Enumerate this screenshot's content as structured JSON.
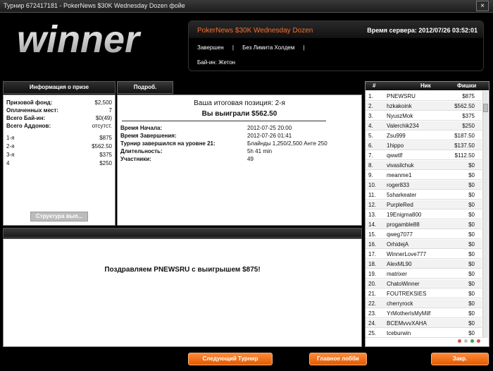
{
  "window": {
    "title": "Турнир 672417181 - PokerNews $30K Wednesday Dozen фойе",
    "close": "×"
  },
  "logo": {
    "text": "winner"
  },
  "header": {
    "tournament_name": "PokerNews $30K Wednesday Dozen",
    "server_time": "Время сервера: 2012/07/26 03:52:01",
    "status": "Завершен",
    "separator": "|",
    "game_type": "Без Лимита Холдем",
    "buyin": "Бай-ин: Жетон"
  },
  "prize_info": {
    "tab_label": "Информация о призе",
    "rows": [
      {
        "label": "Призовой фонд:",
        "value": "$2,500"
      },
      {
        "label": "Оплаченных мест:",
        "value": "7"
      },
      {
        "label": "Всего Бай-ин:",
        "value": "$0(49)"
      },
      {
        "label": "Всего Аддонов:",
        "value": "отсутст."
      }
    ],
    "places": [
      {
        "label": "1-я",
        "value": "$875"
      },
      {
        "label": "2-я",
        "value": "$562.50"
      },
      {
        "label": "3-я",
        "value": "$375"
      },
      {
        "label": "4",
        "value": "$250"
      }
    ],
    "structure_button": "Структура вып..."
  },
  "details": {
    "tab_label": "Подроб.",
    "final_position": "Ваша итоговая позиция: 2-я",
    "winnings": "Вы выиграли $562.50",
    "rows": [
      {
        "label": "Время Начала:",
        "value": "2012-07-25 20:00"
      },
      {
        "label": "Время Завершения:",
        "value": "2012-07-26 01:41"
      },
      {
        "label": "Турнир завершился на уровне 21:",
        "value": "Блайнды 1,250/2,500 Анте 250"
      },
      {
        "label": "Длительность:",
        "value": "5h 41 min"
      },
      {
        "label": "Участники:",
        "value": "49"
      }
    ]
  },
  "message": {
    "text": "Поздравляем PNEWSRU с выигрышем $875!"
  },
  "players": {
    "col_num": "#",
    "col_nick": "Ник",
    "col_chips": "Фишки",
    "rows": [
      {
        "n": "1.",
        "name": "PNEWSRU",
        "chips": "$875"
      },
      {
        "n": "2.",
        "name": "hzkakoink",
        "chips": "$562.50"
      },
      {
        "n": "3.",
        "name": "NyuszMok",
        "chips": "$375"
      },
      {
        "n": "4.",
        "name": "Valerchik234",
        "chips": "$250"
      },
      {
        "n": "5.",
        "name": "Zsu999",
        "chips": "$187.50"
      },
      {
        "n": "6.",
        "name": "1hippo",
        "chips": "$137.50"
      },
      {
        "n": "7.",
        "name": "qwwtlf",
        "chips": "$112.50"
      },
      {
        "n": "8.",
        "name": "vivasilchuk",
        "chips": "$0"
      },
      {
        "n": "9.",
        "name": "meanme1",
        "chips": "$0"
      },
      {
        "n": "10.",
        "name": "roger833",
        "chips": "$0"
      },
      {
        "n": "11.",
        "name": "5sharkeater",
        "chips": "$0"
      },
      {
        "n": "12.",
        "name": "PurpleRed",
        "chips": "$0"
      },
      {
        "n": "13.",
        "name": "19Enigma800",
        "chips": "$0"
      },
      {
        "n": "14.",
        "name": "progamble88",
        "chips": "$0"
      },
      {
        "n": "15.",
        "name": "qweg7077",
        "chips": "$0"
      },
      {
        "n": "16.",
        "name": "OrhidejA",
        "chips": "$0"
      },
      {
        "n": "17.",
        "name": "WinnerLove777",
        "chips": "$0"
      },
      {
        "n": "18.",
        "name": "AlexML90",
        "chips": "$0"
      },
      {
        "n": "19.",
        "name": "matrixer",
        "chips": "$0"
      },
      {
        "n": "20.",
        "name": "ChatoWinner",
        "chips": "$0"
      },
      {
        "n": "21.",
        "name": "FOUTREKSIES",
        "chips": "$0"
      },
      {
        "n": "22.",
        "name": "cherryrock",
        "chips": "$0"
      },
      {
        "n": "23.",
        "name": "YrMotherIsMyMilf",
        "chips": "$0"
      },
      {
        "n": "24.",
        "name": "BCEMvvvXAHA",
        "chips": "$0"
      },
      {
        "n": "25.",
        "name": "tceburwin",
        "chips": "$0"
      }
    ],
    "dots": [
      "#e05050",
      "#c0c0c0",
      "#3aa83a",
      "#e05050"
    ]
  },
  "buttons": {
    "next_tournament": "Следующий Турнир",
    "main_lobby": "Главное лобби",
    "close": "Закр."
  }
}
